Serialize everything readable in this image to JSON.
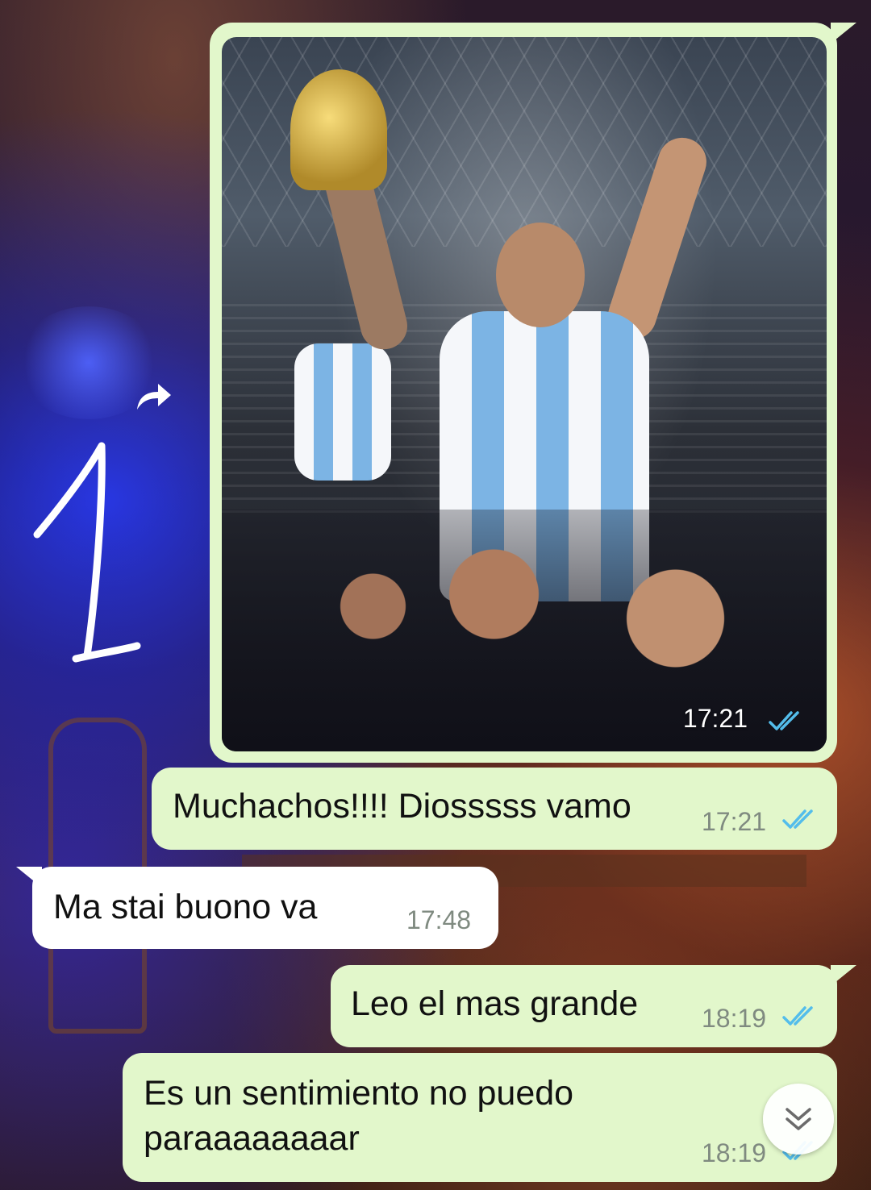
{
  "sticker": {
    "text": "1"
  },
  "messages": [
    {
      "type": "image",
      "direction": "outgoing",
      "time": "17:21",
      "status": "read"
    },
    {
      "type": "text",
      "direction": "outgoing",
      "text": "Muchachos!!!! Diosssss vamo",
      "time": "17:21",
      "status": "read"
    },
    {
      "type": "text",
      "direction": "incoming",
      "text": "Ma stai buono va",
      "time": "17:48"
    },
    {
      "type": "text",
      "direction": "outgoing",
      "text": "Leo el mas grande",
      "time": "18:19",
      "status": "read"
    },
    {
      "type": "text",
      "direction": "outgoing",
      "text": "Es un sentimiento no puedo\nparaaaaaaaar",
      "time": "18:19",
      "status": "read"
    }
  ],
  "icons": {
    "forward": "forward-icon",
    "read_receipt": "double-check-icon",
    "scroll_down": "chevron-double-down-icon"
  },
  "colors": {
    "outgoing_bubble": "#e2f7cb",
    "incoming_bubble": "#ffffff",
    "read_tick": "#53bdeb",
    "timestamp": "#7f8a80"
  }
}
